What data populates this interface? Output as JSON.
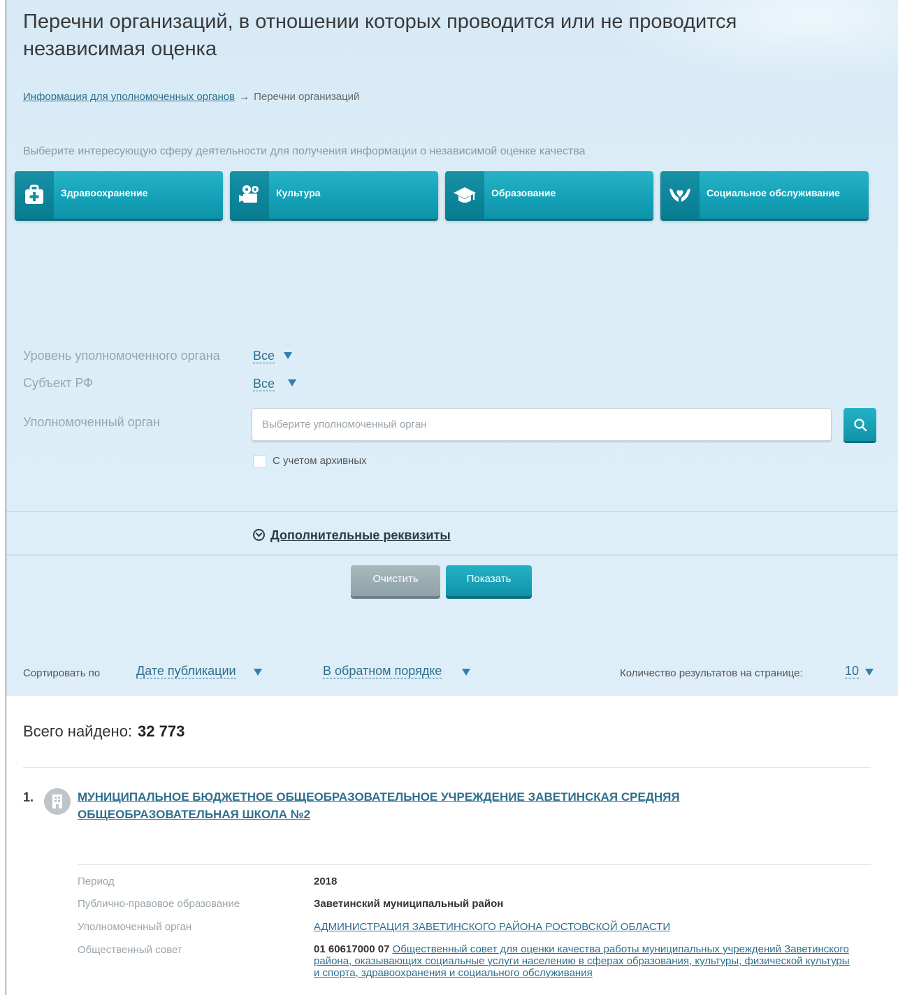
{
  "page": {
    "title": "Перечни организаций, в отношении которых проводится или не проводится независимая оценка"
  },
  "breadcrumb": {
    "link": "Информация для уполномоченных органов",
    "arrow": "→",
    "current": "Перечни организаций"
  },
  "hint": "Выберите интересующую сферу деятельности для получения информации о независимой оценке качества",
  "categories": [
    {
      "label": "Здравоохранение",
      "icon": "medical-kit-icon"
    },
    {
      "label": "Культура",
      "icon": "film-camera-icon"
    },
    {
      "label": "Образование",
      "icon": "graduation-cap-icon"
    },
    {
      "label": "Социальное обслуживание",
      "icon": "caring-hands-icon"
    }
  ],
  "filters": {
    "level_label": "Уровень уполномоченного органа",
    "level_value": "Все",
    "subject_label": "Субъект РФ",
    "subject_value": "Все",
    "authority_label": "Уполномоченный орган",
    "authority_placeholder": "Выберите уполномоченный орган",
    "archive_label": "С учетом архивных",
    "archive_checked": false
  },
  "more_link": "Дополнительные реквизиты",
  "buttons": {
    "clear": "Очистить",
    "show": "Показать"
  },
  "sort": {
    "label": "Сортировать по",
    "field": "Дате публикации",
    "order": "В обратном порядке",
    "per_page_label": "Количество результатов на странице:",
    "per_page": "10"
  },
  "results": {
    "total_label": "Всего найдено:",
    "total": "32 773",
    "items": [
      {
        "number": "1.",
        "title_line1": "МУНИЦИПАЛЬНОЕ БЮДЖЕТНОЕ ОБЩЕОБРАЗОВАТЕЛЬНОЕ УЧРЕЖДЕНИЕ ЗАВЕТИНСКАЯ СРЕДНЯЯ",
        "title_line2": "ОБЩЕОБРАЗОВАТЕЛЬНАЯ ШКОЛА №2",
        "period_label": "Период",
        "period": "2018",
        "municipality_label": "Публично-правовое образование",
        "municipality": "Заветинский муниципальный район",
        "authority_label": "Уполномоченный орган",
        "authority": "АДМИНИСТРАЦИЯ ЗАВЕТИНСКОГО РАЙОНА РОСТОВСКОЙ ОБЛАСТИ",
        "council_label": "Общественный совет",
        "council_code": "01 60617000 07",
        "council_name": "Общественный совет для оценки качества работы муниципальных учреждений Заветинского района, оказывающих социальные услуги населению в сферах образования, культуры, физической культуры и спорта, здравоохранения и социального обслуживания"
      }
    ]
  },
  "colors": {
    "accent": "#13a0b6",
    "link": "#2f6f8e",
    "panel": "#dcedf7"
  }
}
